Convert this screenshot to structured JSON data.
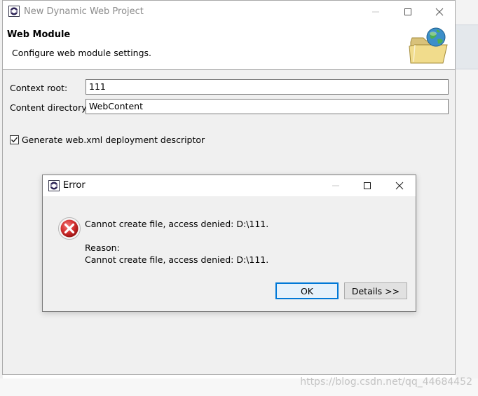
{
  "wizard": {
    "title": "New Dynamic Web Project",
    "header_title": "Web Module",
    "header_description": "Configure web module settings.",
    "banner_icon": "folder-globe-icon",
    "fields": [
      {
        "label": "Context root:",
        "value": "111"
      },
      {
        "label": "Content directory:",
        "value": "WebContent"
      }
    ],
    "checkbox": {
      "label": "Generate web.xml deployment descriptor",
      "checked": true
    }
  },
  "error_dialog": {
    "title": "Error",
    "icon": "error-icon",
    "message": "Cannot create file, access denied: D:\\111.",
    "reason_label": "Reason:",
    "reason_detail": "Cannot create file, access denied: D:\\111.",
    "ok_label": "OK",
    "details_label": "Details >>"
  },
  "watermark": "https://blog.csdn.net/qq_44684452",
  "colors": {
    "accent": "#0078d7",
    "ok_button_bg": "#e5f1fb",
    "dialog_bg": "#f0f0f0",
    "error_red": "#d32f2f"
  }
}
